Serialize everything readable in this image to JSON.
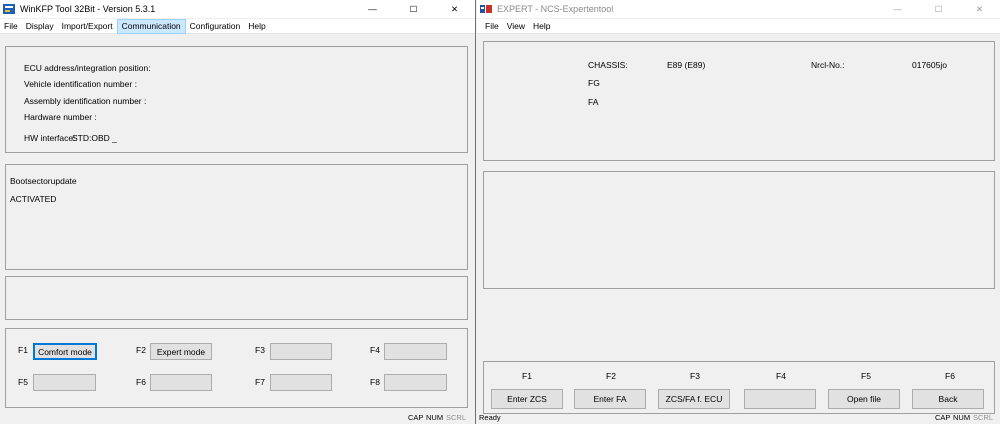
{
  "left_window": {
    "title": "WinKFP Tool 32Bit - Version 5.3.1",
    "caption": {
      "minimize": "—",
      "maximize": "☐",
      "close": "✕"
    },
    "menu": [
      "File",
      "Display",
      "Import/Export",
      "Communication",
      "Configuration",
      "Help"
    ],
    "info_panel": {
      "ecu_address": "ECU address/integration position:",
      "vin": "Vehicle identification number :",
      "assembly": "Assembly identification number :",
      "hardware": "Hardware number :",
      "hw_interface_label": "HW interface:",
      "hw_interface_value": "STD:OBD _"
    },
    "status_panel": {
      "line1": "Bootsectorupdate",
      "line2": "ACTIVATED"
    },
    "fkeys": [
      {
        "key": "F1",
        "label": "Comfort mode"
      },
      {
        "key": "F2",
        "label": "Expert mode"
      },
      {
        "key": "F3",
        "label": ""
      },
      {
        "key": "F4",
        "label": ""
      },
      {
        "key": "F5",
        "label": ""
      },
      {
        "key": "F6",
        "label": ""
      },
      {
        "key": "F7",
        "label": ""
      },
      {
        "key": "F8",
        "label": ""
      }
    ],
    "statusbar": {
      "cap": "CAP",
      "num": "NUM",
      "scrl": "SCRL"
    }
  },
  "right_window": {
    "title": "EXPERT - NCS-Expertentool",
    "caption": {
      "minimize": "—",
      "maximize": "☐",
      "close": "✕"
    },
    "menu": [
      "File",
      "View",
      "Help"
    ],
    "info_panel": {
      "chassis_label": "CHASSIS:",
      "chassis_value": "E89 (E89)",
      "nrcl_label": "Nrcl-No.:",
      "nrcl_value": "017605jo",
      "fg_label": "FG",
      "fa_label": "FA"
    },
    "fkeys": [
      {
        "key": "F1",
        "label": "Enter ZCS"
      },
      {
        "key": "F2",
        "label": "Enter FA"
      },
      {
        "key": "F3",
        "label": "ZCS/FA f. ECU"
      },
      {
        "key": "F4",
        "label": ""
      },
      {
        "key": "F5",
        "label": "Open file"
      },
      {
        "key": "F6",
        "label": "Back"
      }
    ],
    "statusbar": {
      "ready": "Ready",
      "cap": "CAP",
      "num": "NUM",
      "scrl": "SCRL"
    }
  },
  "colors": {
    "window_bg": "#f0f0f0",
    "button_bg": "#e1e1e1",
    "focus": "#0078d7",
    "menu_highlight": "#cce8ff"
  }
}
